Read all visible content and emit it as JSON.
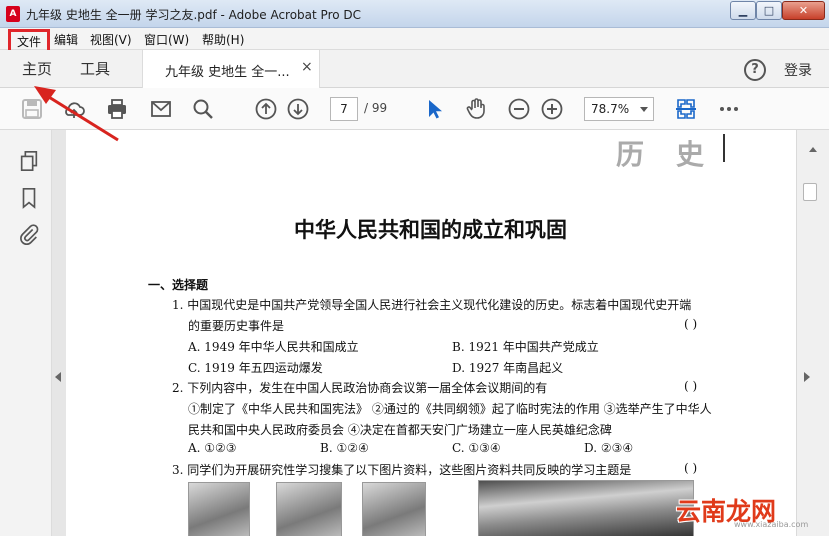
{
  "window": {
    "app_icon": "pdf-icon",
    "title": "九年级 史地生 全一册 学习之友.pdf - Adobe Acrobat Pro DC",
    "buttons": {
      "min": "▁",
      "max": "□",
      "close": "✕"
    }
  },
  "menu": {
    "items": [
      "文件",
      "编辑",
      "视图(V)",
      "窗口(W)",
      "帮助(H)"
    ],
    "highlight_color": "#e0262b"
  },
  "tabs": {
    "home": "主页",
    "tools": "工具",
    "document": "九年级 史地生 全一...",
    "close": "×",
    "help": "?",
    "login": "登录"
  },
  "toolbar": {
    "icons": [
      "save-icon",
      "cloud-upload-icon",
      "print-icon",
      "email-icon",
      "search-icon",
      "page-up-icon",
      "page-down-icon",
      "select-cursor-icon",
      "hand-icon",
      "zoom-out-icon",
      "zoom-in-icon",
      "scan-icon",
      "more-icon"
    ],
    "page_current": "7",
    "page_total": "/ 99",
    "zoom": "78.7%"
  },
  "left_rail": {
    "icons": [
      "pages-icon",
      "bookmark-icon",
      "attachment-icon"
    ]
  },
  "document": {
    "subject": "历史",
    "title": "中华人民共和国的成立和巩固",
    "section": "一、选择题",
    "lines": [
      "1. 中国现代史是中国共产党领导全国人民进行社会主义现代化建设的历史。标志着中国现代史开端",
      "的重要历史事件是",
      "A. 1949 年中华人民共和国成立",
      "B. 1921 年中国共产党成立",
      "C. 1919 年五四运动爆发",
      "D. 1927 年南昌起义",
      "2. 下列内容中，发生在中国人民政治协商会议第一届全体会议期间的有",
      "①制定了《中华人民共和国宪法》 ②通过的《共同纲领》起了临时宪法的作用 ③选举产生了中华人",
      "民共和国中央人民政府委员会 ④决定在首都天安门广场建立一座人民英雄纪念碑",
      "A. ①②③",
      "B. ①②④",
      "C. ①③④",
      "D. ②③④",
      "3. 同学们为开展研究性学习搜集了以下图片资料，这些图片资料共同反映的学习主题是"
    ],
    "answer_paren": "(        )"
  },
  "watermark": {
    "text": "云南龙网",
    "url": "www.xiazaiba.com"
  }
}
